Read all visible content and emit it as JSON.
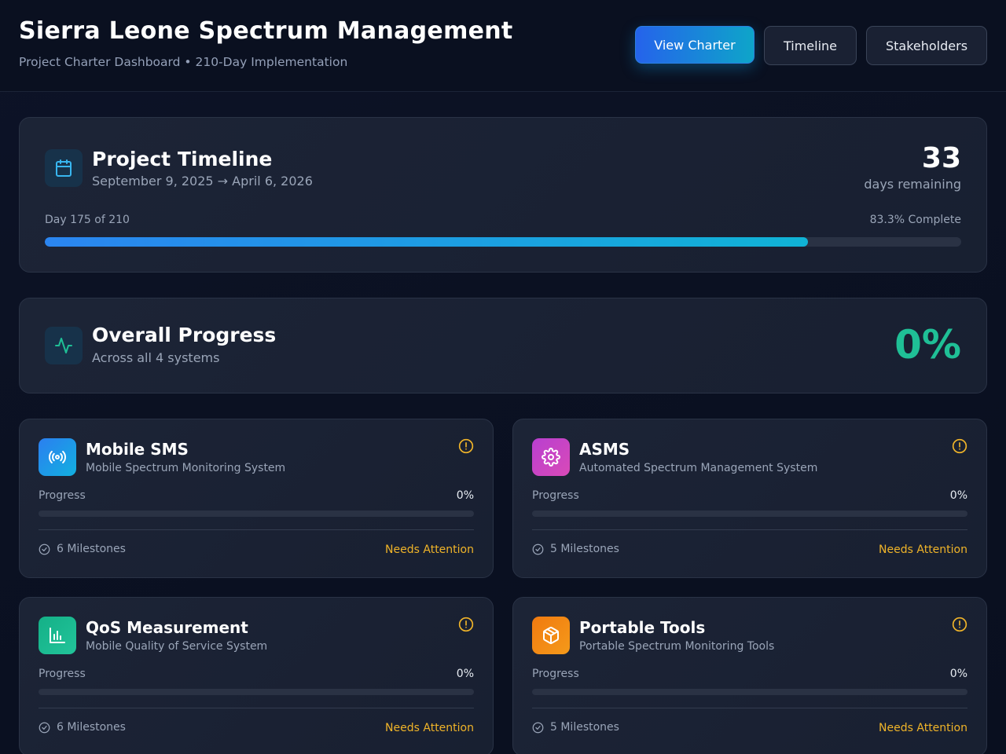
{
  "header": {
    "title": "Sierra Leone Spectrum Management",
    "subtitle": "Project Charter Dashboard • 210-Day Implementation",
    "nav": {
      "view_charter": "View Charter",
      "timeline": "Timeline",
      "stakeholders": "Stakeholders"
    }
  },
  "timeline": {
    "title": "Project Timeline",
    "dates": "September 9, 2025 → April 6, 2026",
    "days_remaining": "33",
    "days_remaining_label": "days remaining",
    "day_of": "Day 175 of 210",
    "percent_complete": "83.3% Complete",
    "progress_fraction": 0.833
  },
  "overall": {
    "title": "Overall Progress",
    "subtitle": "Across all 4 systems",
    "percent": "0%"
  },
  "colors": {
    "accent_blue": "#2b85f0",
    "accent_cyan": "#10b3d6",
    "success_green": "#1fbf96",
    "warning_amber": "#f0b429"
  },
  "systems": [
    {
      "title": "Mobile SMS",
      "subtitle": "Mobile Spectrum Monitoring System",
      "progress_label": "Progress",
      "progress_value": "0%",
      "progress_fraction": 0,
      "milestones": "6 Milestones",
      "status": "Needs Attention",
      "icon": "broadcast-icon",
      "icon_color": "#1e88e5"
    },
    {
      "title": "ASMS",
      "subtitle": "Automated Spectrum Management System",
      "progress_label": "Progress",
      "progress_value": "0%",
      "progress_fraction": 0,
      "milestones": "5 Milestones",
      "status": "Needs Attention",
      "icon": "gear-icon",
      "icon_color": "#c042c9"
    },
    {
      "title": "QoS Measurement",
      "subtitle": "Mobile Quality of Service System",
      "progress_label": "Progress",
      "progress_value": "0%",
      "progress_fraction": 0,
      "milestones": "6 Milestones",
      "status": "Needs Attention",
      "icon": "bar-chart-icon",
      "icon_color": "#19b98c"
    },
    {
      "title": "Portable Tools",
      "subtitle": "Portable Spectrum Monitoring Tools",
      "progress_label": "Progress",
      "progress_value": "0%",
      "progress_fraction": 0,
      "milestones": "5 Milestones",
      "status": "Needs Attention",
      "icon": "package-icon",
      "icon_color": "#f08010"
    }
  ]
}
